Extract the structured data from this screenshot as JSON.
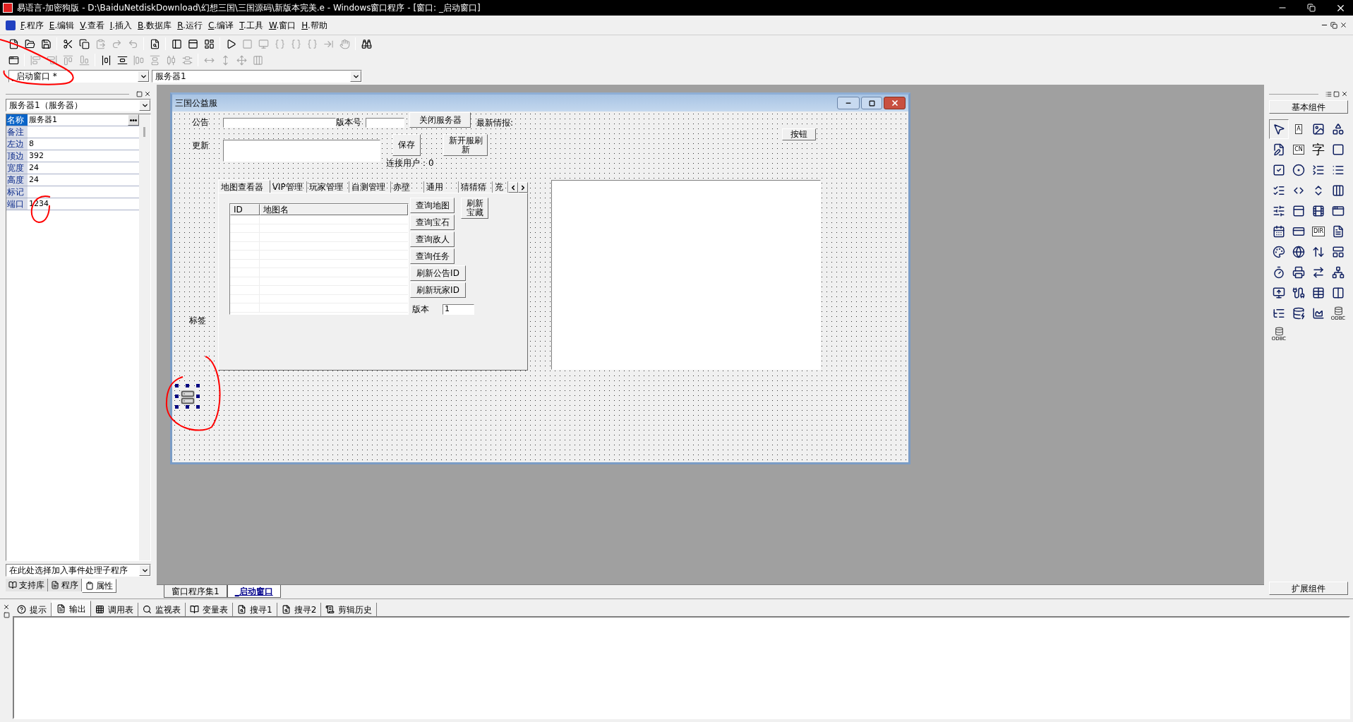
{
  "title_bar": {
    "title": "易语言-加密狗版 - D:\\BaiduNetdiskDownload\\幻想三国\\三国源码\\新版本完美.e - Windows窗口程序 - [窗口: _启动窗口]"
  },
  "menu": [
    "F.程序",
    "E.编辑",
    "V.查看",
    "I.插入",
    "B.数据库",
    "R.运行",
    "C.编译",
    "T.工具",
    "W.窗口",
    "H.帮助"
  ],
  "toolbar_1": [
    {
      "disabled": false
    },
    {
      "disabled": false
    },
    {
      "disabled": false
    },
    {
      "disabled": false
    },
    {
      "disabled": false
    },
    {
      "disabled": true
    },
    {
      "disabled": true
    },
    {
      "disabled": true
    },
    {
      "disabled": false
    },
    {
      "disabled": false
    },
    {
      "disabled": false
    },
    {
      "disabled": false
    },
    {
      "disabled": false
    },
    {
      "disabled": true
    },
    {
      "disabled": true
    },
    {
      "disabled": true
    },
    {
      "disabled": true
    },
    {
      "disabled": true
    },
    {
      "disabled": true
    },
    {
      "disabled": true
    },
    {
      "disabled": false
    }
  ],
  "toolbar_2": [
    {
      "disabled": false
    },
    {
      "disabled": true
    },
    {
      "disabled": true
    },
    {
      "disabled": true
    },
    {
      "disabled": true
    },
    {
      "disabled": false
    },
    {
      "disabled": false
    },
    {
      "disabled": true
    },
    {
      "disabled": true
    },
    {
      "disabled": true
    },
    {
      "disabled": true
    },
    {
      "disabled": true
    },
    {
      "disabled": true
    },
    {
      "disabled": true
    },
    {
      "disabled": true
    }
  ],
  "window_combo": {
    "value": "_启动窗口 *"
  },
  "object_combo_top": {
    "value": "服务器1"
  },
  "properties_panel": {
    "object_combo": "服务器1（服务器）",
    "rows": [
      {
        "name": "名称",
        "value": "服务器1",
        "selected": true
      },
      {
        "name": "备注",
        "selected": false
      },
      {
        "name": "左边",
        "value": "8",
        "selected": false
      },
      {
        "name": "顶边",
        "value": "392",
        "selected": false
      },
      {
        "name": "宽度",
        "value": "24",
        "selected": false
      },
      {
        "name": "高度",
        "value": "24",
        "selected": false
      },
      {
        "name": "标记",
        "selected": false
      },
      {
        "name": "端口",
        "value": "1234",
        "selected": false
      }
    ],
    "event_combo": "在此处选择加入事件处理子程序",
    "tabs": [
      {
        "label": "支持库",
        "selected": false
      },
      {
        "label": "程序",
        "selected": false
      },
      {
        "label": "属性",
        "selected": true
      }
    ]
  },
  "designer": {
    "title": "三国公益服",
    "controls": [
      {
        "kind": "label",
        "text": "公告"
      },
      {
        "kind": "input"
      },
      {
        "kind": "label",
        "text": "版本号"
      },
      {
        "kind": "input"
      },
      {
        "kind": "button",
        "text": "关闭服务器"
      },
      {
        "kind": "label",
        "text": "最新情报:"
      },
      {
        "kind": "label",
        "text": "更新"
      },
      {
        "kind": "input"
      },
      {
        "kind": "button",
        "text": "保存"
      },
      {
        "kind": "button",
        "text": "新开服刷新"
      },
      {
        "kind": "label",
        "text": "连接用户：0"
      },
      {
        "kind": "button",
        "text": "按钮"
      },
      {
        "kind": "listbox"
      },
      {
        "kind": "label",
        "text": "标签"
      },
      {
        "kind": "component",
        "selected": true
      }
    ],
    "tab_control": {
      "tabs": [
        {
          "label": "地图查看器",
          "selected": true
        },
        {
          "label": "VIP管理",
          "selected": false
        },
        {
          "label": "玩家管理",
          "selected": false
        },
        {
          "label": "自测管理",
          "selected": false
        },
        {
          "label": "赤壁",
          "selected": false
        },
        {
          "label": "通用",
          "selected": false
        },
        {
          "label": "猜猜猜",
          "selected": false
        },
        {
          "label": "充",
          "selected": false
        }
      ],
      "columns": [
        "ID",
        "地图名"
      ],
      "buttons": [
        "查询地图",
        "查询宝石",
        "查询敌人",
        "查询任务",
        "刷新公告ID",
        "刷新玩家ID",
        "刷新宝藏"
      ],
      "version_label": "版本",
      "version_value": "1"
    }
  },
  "document_tabs": [
    {
      "label": "窗口程序集1",
      "selected": false
    },
    {
      "label": "_启动窗口",
      "selected": true
    }
  ],
  "toolbox": {
    "header": "基本组件",
    "footer": "扩展组件",
    "items": [
      {
        "kind": "icon"
      },
      {
        "kind": "boxed",
        "text": "A"
      },
      {
        "kind": "icon"
      },
      {
        "kind": "icon"
      },
      {
        "kind": "icon"
      },
      {
        "kind": "boxed",
        "text": "CN"
      },
      {
        "kind": "glyph",
        "text": "字"
      },
      {
        "kind": "icon"
      },
      {
        "kind": "icon"
      },
      {
        "kind": "icon"
      },
      {
        "kind": "icon"
      },
      {
        "kind": "icon"
      },
      {
        "kind": "icon"
      },
      {
        "kind": "icon"
      },
      {
        "kind": "icon"
      },
      {
        "kind": "icon"
      },
      {
        "kind": "icon"
      },
      {
        "kind": "icon"
      },
      {
        "kind": "icon"
      },
      {
        "kind": "icon"
      },
      {
        "kind": "icon"
      },
      {
        "kind": "icon"
      },
      {
        "kind": "boxed",
        "text": "DIR"
      },
      {
        "kind": "icon"
      },
      {
        "kind": "icon"
      },
      {
        "kind": "icon"
      },
      {
        "kind": "icon"
      },
      {
        "kind": "icon"
      },
      {
        "kind": "icon"
      },
      {
        "kind": "icon"
      },
      {
        "kind": "icon"
      },
      {
        "kind": "icon"
      },
      {
        "kind": "icon"
      },
      {
        "kind": "icon"
      },
      {
        "kind": "icon"
      },
      {
        "kind": "icon"
      },
      {
        "kind": "icon"
      },
      {
        "kind": "icon"
      },
      {
        "kind": "icon"
      },
      {
        "kind": "captioned",
        "text": "ODBC"
      },
      {
        "kind": "captioned",
        "text": "ODBC"
      }
    ]
  },
  "output_panel": {
    "tabs": [
      {
        "label": "提示",
        "selected": false
      },
      {
        "label": "输出",
        "selected": true
      },
      {
        "label": "调用表",
        "selected": false
      },
      {
        "label": "监视表",
        "selected": false
      },
      {
        "label": "变量表",
        "selected": false
      },
      {
        "label": "搜寻1",
        "selected": false
      },
      {
        "label": "搜寻2",
        "selected": false
      },
      {
        "label": "剪辑历史",
        "selected": false
      }
    ]
  }
}
